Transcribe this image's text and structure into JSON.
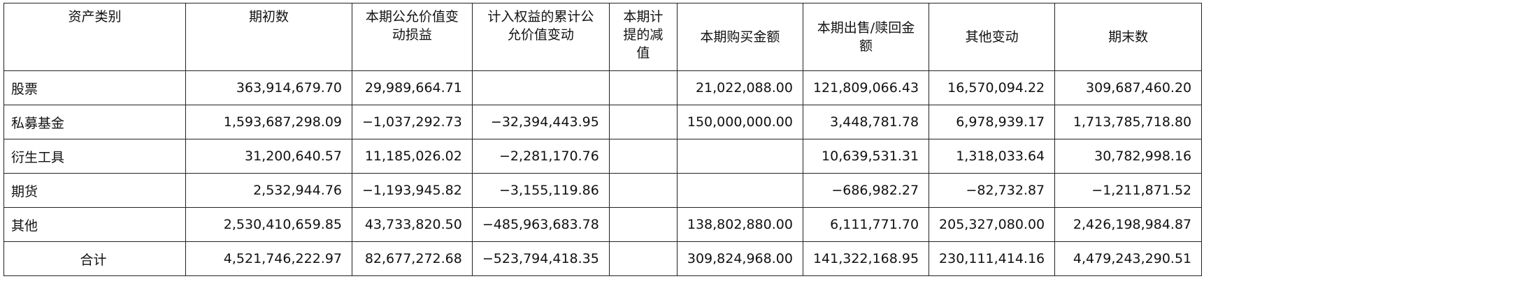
{
  "table": {
    "headers": [
      "资产类别",
      "期初数",
      "本期公允价值变动损益",
      "计入权益的累计公允价值变动",
      "本期计提的减值",
      "本期购买金额",
      "本期出售/赎回金额",
      "其他变动",
      "期末数"
    ],
    "rows": [
      {
        "category": "股票",
        "cells": [
          "363,914,679.70",
          "29,989,664.71",
          "",
          "",
          "21,022,088.00",
          "121,809,066.43",
          "16,570,094.22",
          "309,687,460.20"
        ]
      },
      {
        "category": "私募基金",
        "cells": [
          "1,593,687,298.09",
          "−1,037,292.73",
          "−32,394,443.95",
          "",
          "150,000,000.00",
          "3,448,781.78",
          "6,978,939.17",
          "1,713,785,718.80"
        ]
      },
      {
        "category": "衍生工具",
        "cells": [
          "31,200,640.57",
          "11,185,026.02",
          "−2,281,170.76",
          "",
          "",
          "10,639,531.31",
          "1,318,033.64",
          "30,782,998.16"
        ]
      },
      {
        "category": "期货",
        "cells": [
          "2,532,944.76",
          "−1,193,945.82",
          "−3,155,119.86",
          "",
          "",
          "−686,982.27",
          "−82,732.87",
          "−1,211,871.52"
        ]
      },
      {
        "category": "其他",
        "cells": [
          "2,530,410,659.85",
          "43,733,820.50",
          "−485,963,683.78",
          "",
          "138,802,880.00",
          "6,111,771.70",
          "205,327,080.00",
          "2,426,198,984.87"
        ]
      }
    ],
    "total": {
      "category": "合计",
      "cells": [
        "4,521,746,222.97",
        "82,677,272.68",
        "−523,794,418.35",
        "",
        "309,824,968.00",
        "141,322,168.95",
        "230,111,414.16",
        "4,479,243,290.51"
      ]
    }
  }
}
